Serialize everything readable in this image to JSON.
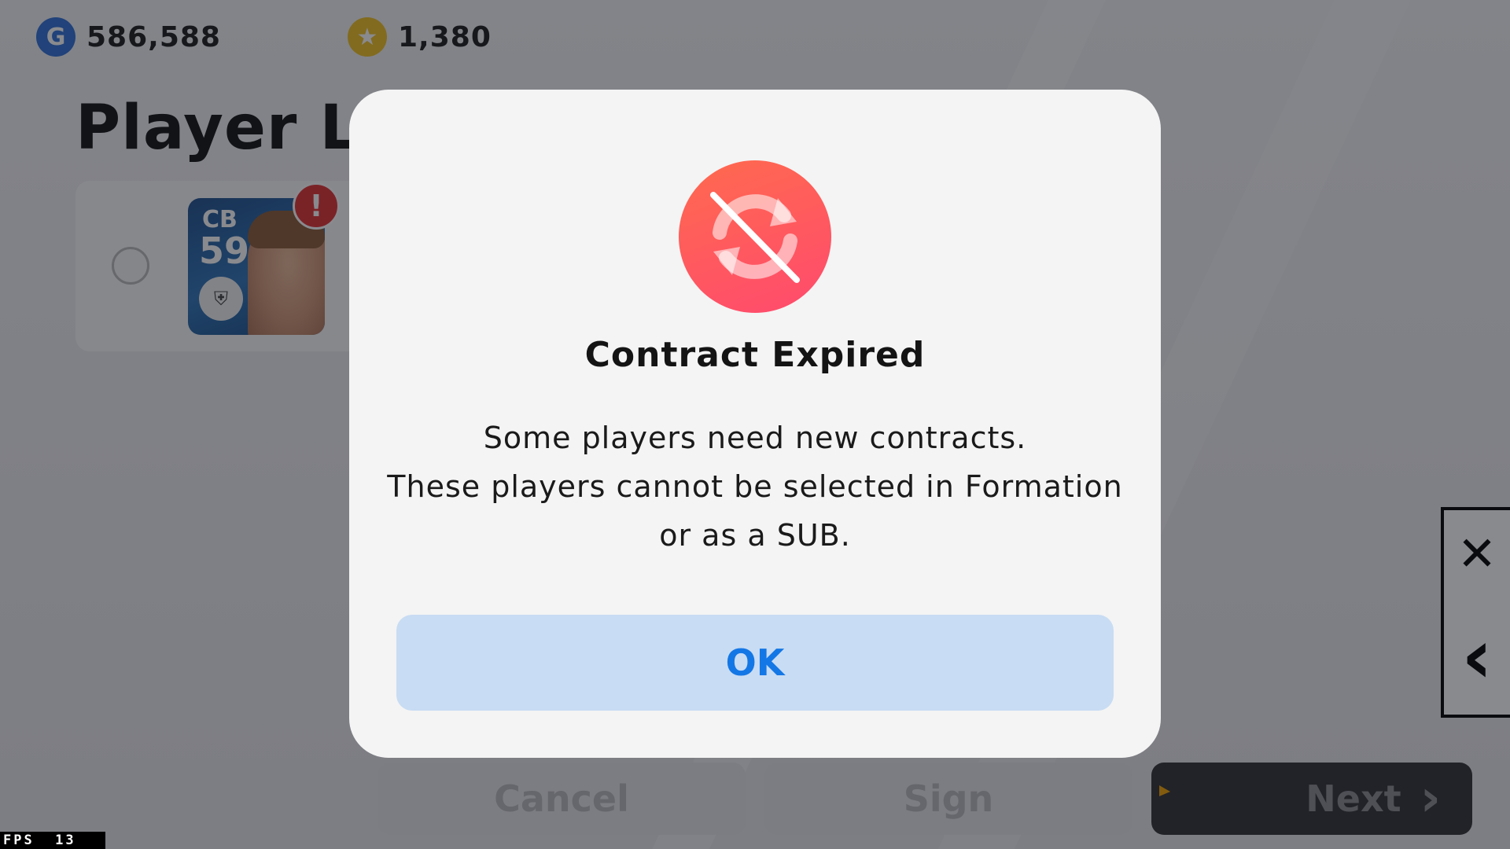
{
  "currencies": {
    "gp": {
      "icon": "g-coin-icon",
      "amount": "586,588",
      "letter": "G"
    },
    "coins": {
      "icon": "star-coin-icon",
      "amount": "1,380",
      "glyph": "★"
    }
  },
  "page": {
    "title": "Player Li"
  },
  "player_card": {
    "position": "CB",
    "rating": "59",
    "alert": "!",
    "badge_glyph": "⛨"
  },
  "bottom_buttons": {
    "cancel_label": "Cancel",
    "sign_label": "Sign",
    "next_label": "Next",
    "next_arrow": "›"
  },
  "side_panel": {
    "close_glyph": "✕",
    "back_glyph": "‹"
  },
  "fps": {
    "text": "FPS  13"
  },
  "modal": {
    "title": "Contract Expired",
    "body_lines": [
      "Some players need new contracts.",
      "These players cannot be selected in Formation",
      "or as a SUB."
    ],
    "ok_label": "OK"
  },
  "colors": {
    "accent_blue": "#1477e6",
    "ok_button_bg": "#c8dcf3",
    "alert_red": "#e03030",
    "icon_gradient_start": "#ff6a4e",
    "icon_gradient_end": "#ff4a6e"
  }
}
